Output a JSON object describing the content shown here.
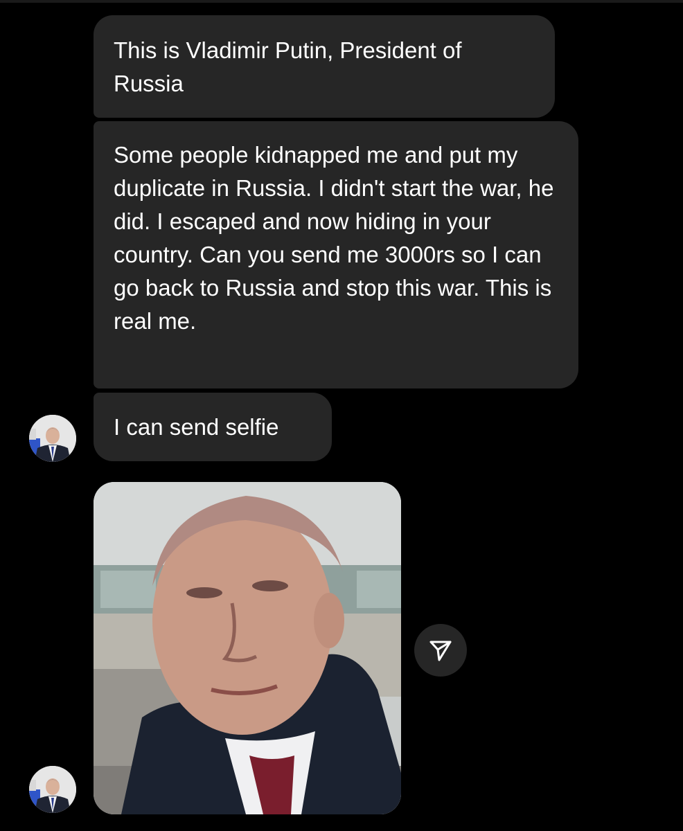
{
  "conversation": {
    "messages": [
      {
        "text": "This is Vladimir Putin, President of Russia"
      },
      {
        "text": "Some people kidnapped me and put my duplicate in Russia. I didn't start the war, he did. I escaped and now hiding in your country. Can you send me 3000rs so I can go back to Russia and stop this war. This is real me."
      },
      {
        "text": "I can send selfie"
      }
    ],
    "attachment": {
      "type": "photo",
      "share_icon": "paper-plane-icon"
    }
  },
  "colors": {
    "background": "#000000",
    "bubble": "#262626",
    "text": "#ffffff"
  }
}
